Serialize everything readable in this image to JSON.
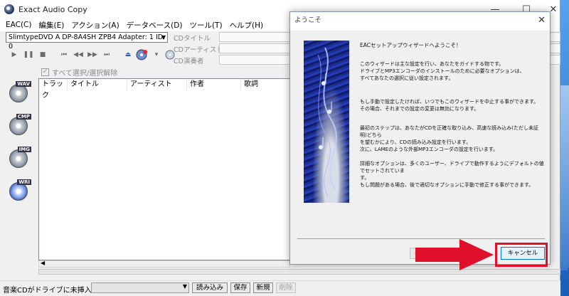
{
  "main_window": {
    "title": "Exact Audio Copy",
    "controls": {
      "minimize": "—",
      "maximize": "☐",
      "close": "✕"
    },
    "menu": [
      "EAC(C)",
      "編集(E)",
      "アクション(A)",
      "データベース(D)",
      "ツール(T)",
      "ヘルプ(H)"
    ],
    "drive": {
      "selected": "SlimtypeDVD A  DP-8A4SH ZPB4   Adapter: 1  ID: 0"
    },
    "cd_fields": {
      "title_label": "CDタイトル",
      "artist_label": "CDアーティスト",
      "composer_label": "CD演奏者"
    },
    "select_all_label": "すべて選択/選択解除",
    "sidebar": [
      {
        "tag": "WAV",
        "icon": "wav-cd-icon"
      },
      {
        "tag": "CMP",
        "icon": "compress-cd-icon"
      },
      {
        "tag": "IMG",
        "icon": "image-cd-icon"
      },
      {
        "tag": "WRI",
        "icon": "write-cd-icon"
      }
    ],
    "track_columns": [
      "トラック",
      "タイトル",
      "アーティスト",
      "作者",
      "歌詞"
    ],
    "status": {
      "text": "音楽CDがドライブに未挿入",
      "buttons": {
        "load": "読み込み",
        "save": "保存",
        "new": "新規",
        "delete": "削除"
      }
    }
  },
  "dialog": {
    "title": "ようこそ",
    "close": "✕",
    "heading": "EACセットアップウィザードへようこそ！",
    "paragraphs": [
      "このウィザードは主な設定を行い、あなたをガイドする物です。\nドライブとMP3エンコーダのインストールのために必要なオプションは、\nすべてあなたの選択に従い設定されます。",
      "もし手動で設定したければ、いつでもこのウィザードを中止する事ができます。\nその場合、それまでの設定の変更は無効になります。",
      "最初のステップは、あなたがCDを正確な取り込み、高速な読み込み(ただし未証明)どちら\nを望むかにより、CDの読み込み設定を行います。\n次に、LAMEのような外部MP3エンコーダの設定を行います。",
      "詳細なオプションは、多くのユーザー、ドライブで動作するようにデフォルトの値でセットされていま\nす。\nもし問題がある場合、後で適切なオプションに手動で修正する事ができます。"
    ],
    "back_label": "< 戻",
    "cancel_label": "キャンセル"
  },
  "annotation": {
    "color": "#e0102a"
  }
}
